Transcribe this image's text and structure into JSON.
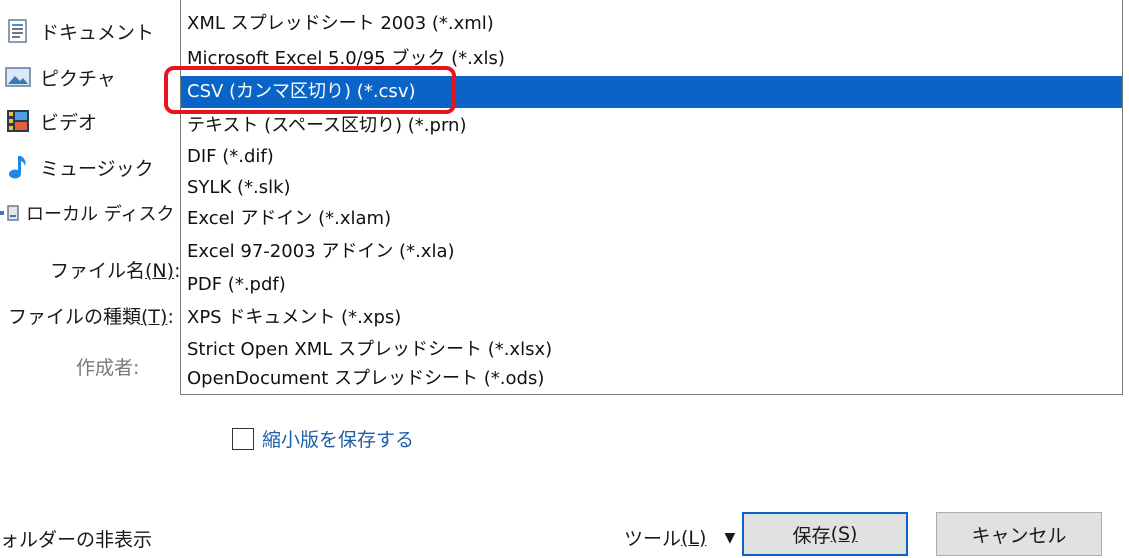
{
  "nav": {
    "items": [
      {
        "label": "ドキュメント"
      },
      {
        "label": "ピクチャ"
      },
      {
        "label": "ビデオ"
      },
      {
        "label": "ミュージック"
      },
      {
        "label": "ローカル ディスク"
      }
    ]
  },
  "fields": {
    "filename_label": "ファイル名",
    "filename_accel": "(N)",
    "filetype_label": "ファイルの種類",
    "filetype_accel": "(T)",
    "author_label": "作成者:",
    "label_colon": ":"
  },
  "dropdown": {
    "options": [
      {
        "label": "XML スプレッドシート 2003 (*.xml)"
      },
      {
        "label": "Microsoft Excel 5.0/95 ブック (*.xls)"
      },
      {
        "label": "CSV (カンマ区切り) (*.csv)",
        "selected": true
      },
      {
        "label": "テキスト (スペース区切り) (*.prn)"
      },
      {
        "label": "DIF (*.dif)"
      },
      {
        "label": "SYLK (*.slk)"
      },
      {
        "label": "Excel アドイン (*.xlam)"
      },
      {
        "label": "Excel 97-2003 アドイン (*.xla)"
      },
      {
        "label": "PDF (*.pdf)"
      },
      {
        "label": "XPS ドキュメント (*.xps)"
      },
      {
        "label": "Strict Open XML スプレッドシート (*.xlsx)"
      },
      {
        "label": "OpenDocument スプレッドシート (*.ods)"
      }
    ],
    "highlight_color": "#e8141d",
    "selected_color": "#0a64c8"
  },
  "save_thumbnail": {
    "label": "縮小版を保存する",
    "checked": false
  },
  "footer": {
    "hide_folders": "ォルダーの非表示",
    "tools_label": "ツール",
    "tools_accel": "(L)",
    "save_label": "保存",
    "save_accel": "(S)",
    "cancel_label": "キャンセル"
  }
}
